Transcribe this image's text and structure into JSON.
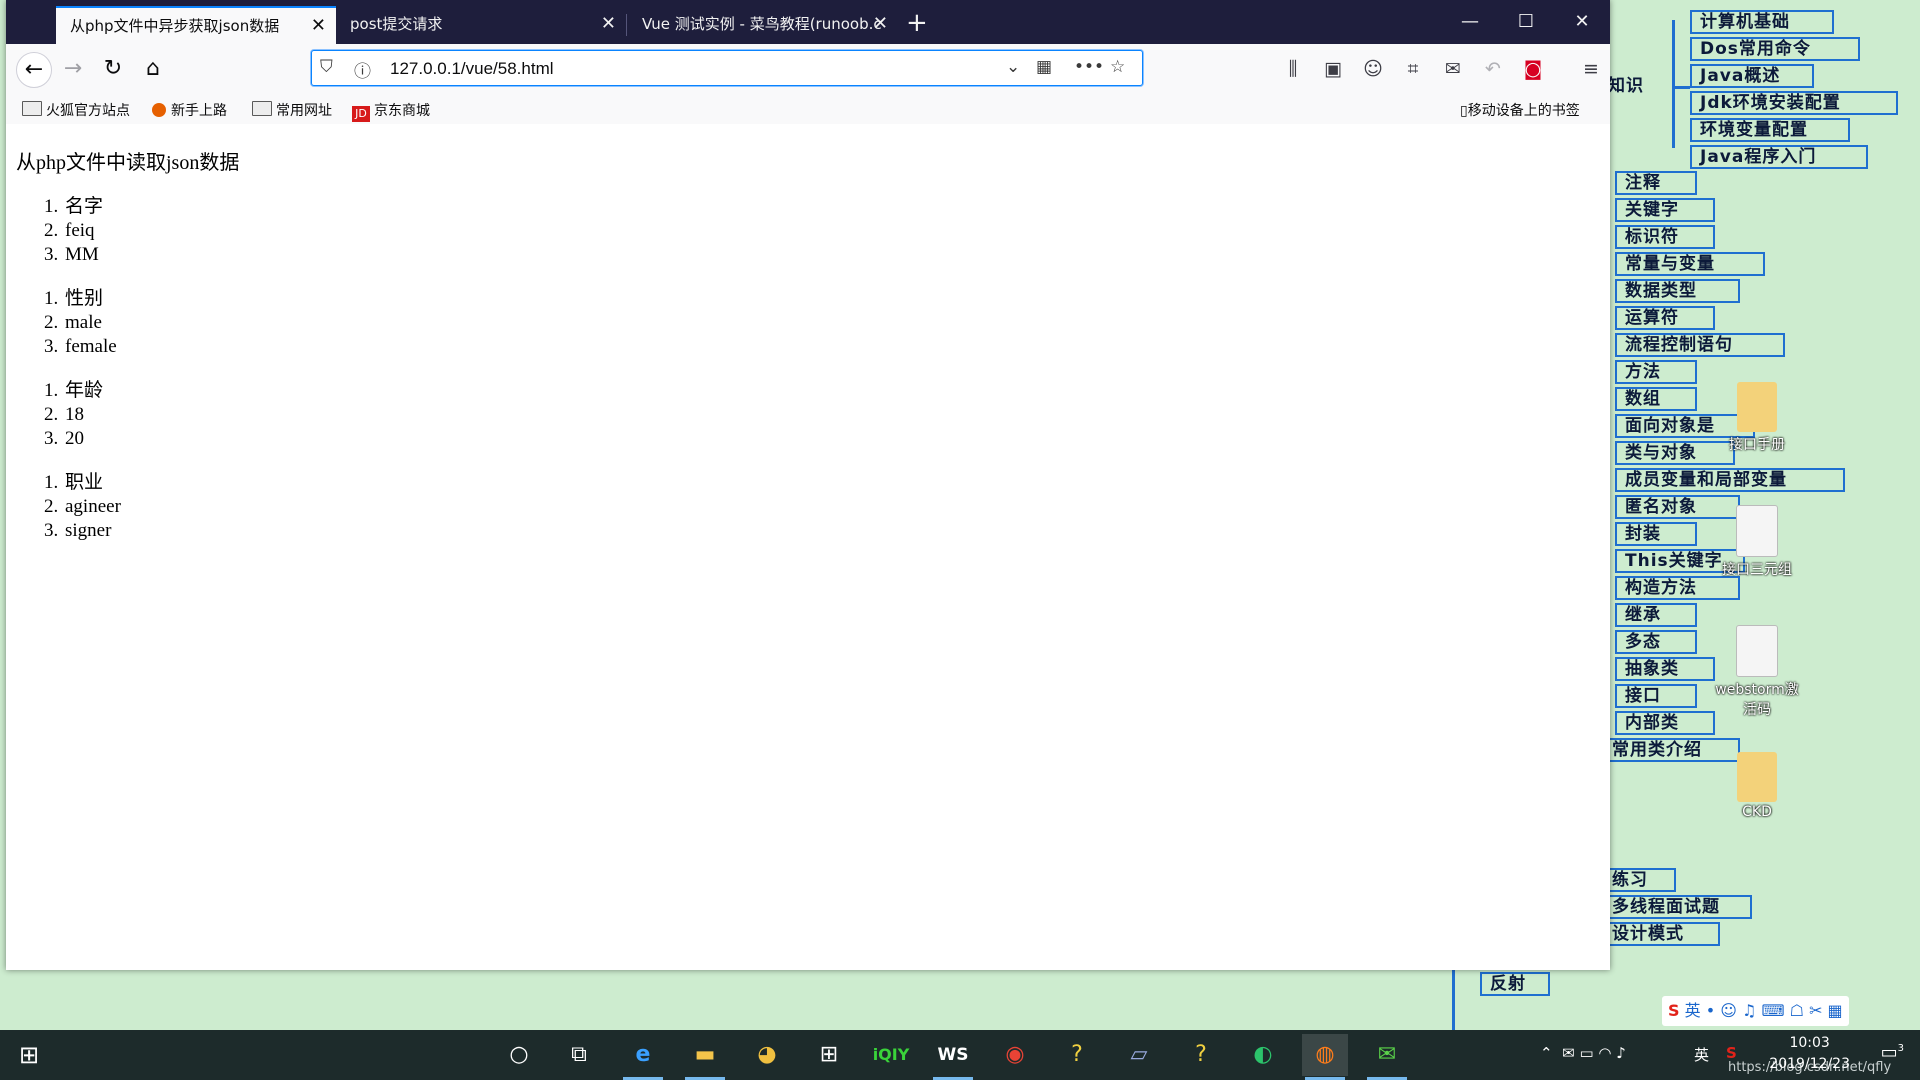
{
  "mindmap": {
    "items": [
      "计算机基础",
      "Dos常用命令",
      "Java概述",
      "Jdk环境安装配置",
      "环境变量配置",
      "Java程序入门",
      "注释",
      "关键字",
      "标识符",
      "常量与变量",
      "数据类型",
      "运算符",
      "流程控制语句",
      "方法",
      "数组",
      "面向对象是",
      "类与对象",
      "成员变量和局部变量",
      "匿名对象",
      "封装",
      "This关键字",
      "构造方法",
      "继承",
      "多态",
      "抽象类",
      "接口",
      "内部类",
      "常用类介绍",
      "练习",
      "多线程面试题",
      "设计模式",
      "反射"
    ],
    "fragment_label": "知识"
  },
  "desktop_icons": [
    "接口手册",
    "接口三元组",
    "webstorm激活码",
    "CKD"
  ],
  "browser": {
    "tabs": [
      {
        "label": "从php文件中异步获取json数据",
        "active": true
      },
      {
        "label": "post提交请求",
        "active": false
      },
      {
        "label": "Vue 测试实例 - 菜鸟教程(runoob.c",
        "active": false
      }
    ],
    "new_tab_symbol": "+",
    "url": "127.0.0.1/vue/58.html",
    "bookmarks": [
      "火狐官方站点",
      "新手上路",
      "常用网址",
      "京东商城"
    ],
    "mobile_bookmarks": "移动设备上的书签"
  },
  "page": {
    "heading": "从php文件中读取json数据",
    "lists": [
      [
        "名字",
        "feiq",
        "MM"
      ],
      [
        "性别",
        "male",
        "female"
      ],
      [
        "年龄",
        "18",
        "20"
      ],
      [
        "职业",
        "agineer",
        "signer"
      ]
    ]
  },
  "taskbar": {
    "time": "10:03",
    "date": "2019/12/23",
    "ime_label": "英",
    "tray_lang": "英",
    "notification_count": "3",
    "watermark": "https://blog.csdn.net/qfly"
  },
  "colors": {
    "accent": "#0a84ff",
    "titlebar": "#1e1e3c",
    "desktop": "#cdeccf",
    "mindmap_border": "#1f6fd0"
  }
}
